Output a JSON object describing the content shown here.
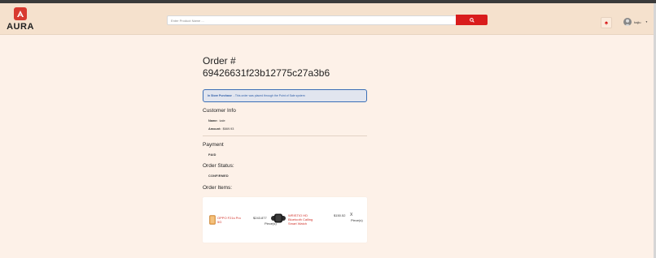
{
  "brand": {
    "name": "AURA",
    "accent": "#d83a30"
  },
  "search": {
    "placeholder": "Enter Product Name ...",
    "button_icon": "search-icon"
  },
  "header": {
    "notification_icon": "bell-icon",
    "user_name": "hajiu",
    "user_caret": "▾"
  },
  "order": {
    "title": "Order #",
    "id": "69426631f23b12775c27a3b6",
    "notice_label": "In Store Purchase",
    "notice_text": "- This order was placed through the Point of Sale system",
    "customer_info_title": "Customer Info",
    "name_label": "Name:",
    "name_value": "kale",
    "amount_label": "Amount:",
    "amount_value": "$669.93",
    "payment_title": "Payment",
    "payment_status": "PAID",
    "order_status_title": "Order Status:",
    "order_status": "CONFIRMED",
    "order_items_title": "Order Items:"
  },
  "items": [
    {
      "name_line1": "OPPO F21s Pro",
      "name_line2": "5G",
      "price": "$243.877",
      "qty": "Piece(s)"
    },
    {
      "name_line1": "WRISTIO HD",
      "name_line2": "Bluetooth Calling",
      "name_line3": "Smart Watch",
      "price": "$150.52",
      "qty_prefix": "X",
      "qty": "Piece(s)"
    }
  ]
}
